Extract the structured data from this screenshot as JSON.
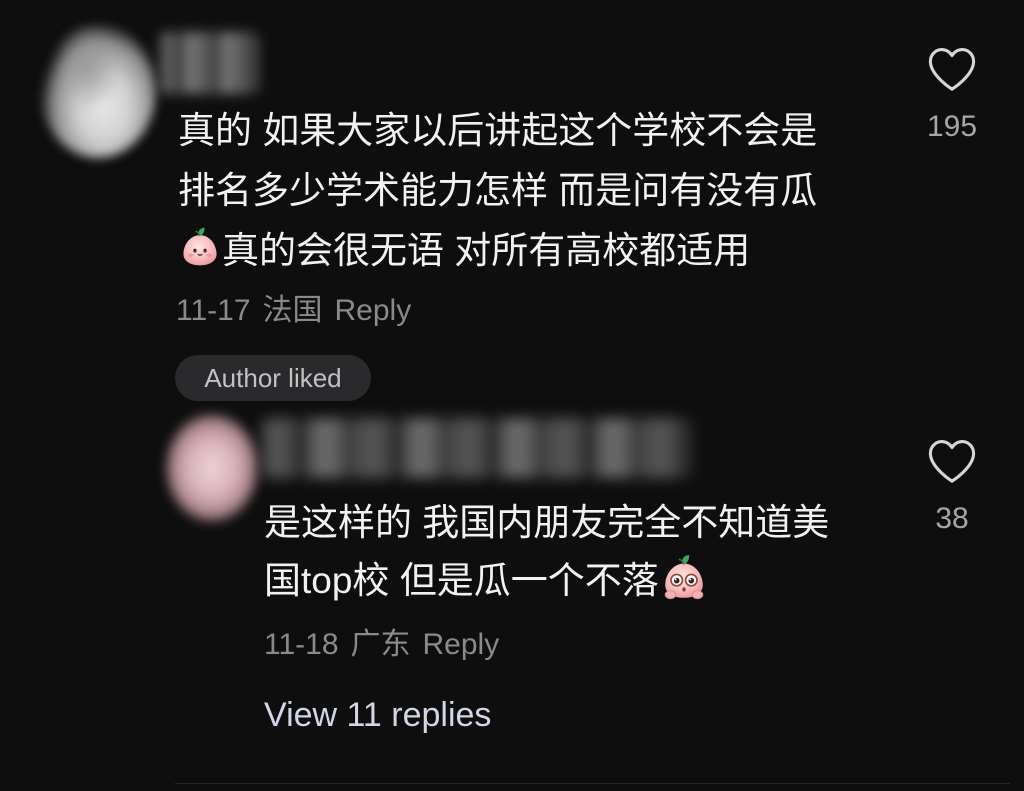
{
  "theme": {
    "background": "#0e0e0f",
    "text": "#f2f2f2",
    "meta": "#8a8a8c",
    "count": "#a6a6a8",
    "badge_bg": "#2a2a2c",
    "badge_text": "#c2c2c4",
    "view_replies": "#d2d6e6"
  },
  "thread": {
    "comment": {
      "avatar_icon": "blurred-avatar-icon",
      "lines": [
        {
          "text": "真的 如果大家以后讲起这个学校不会是"
        },
        {
          "text": "排名多少学术能力怎样 而是问有没有瓜"
        },
        {
          "emoji_before": "peach-smile-emoji-icon",
          "text": "真的会很无语 对所有高校都适用"
        }
      ],
      "date": "11-17",
      "location": "法国",
      "reply_label": "Reply",
      "badge": "Author liked",
      "like_icon": "heart-outline-icon",
      "like_count": "195"
    },
    "replies": [
      {
        "avatar_icon": "blurred-avatar-icon",
        "lines": [
          {
            "text": "是这样的 我国内朋友完全不知道美"
          },
          {
            "text": "国top校 但是瓜一个不落",
            "emoji_after": "peach-wow-emoji-icon"
          }
        ],
        "date": "11-18",
        "location": "广东",
        "reply_label": "Reply",
        "like_icon": "heart-outline-icon",
        "like_count": "38"
      }
    ],
    "view_replies_label": "View 11 replies"
  }
}
